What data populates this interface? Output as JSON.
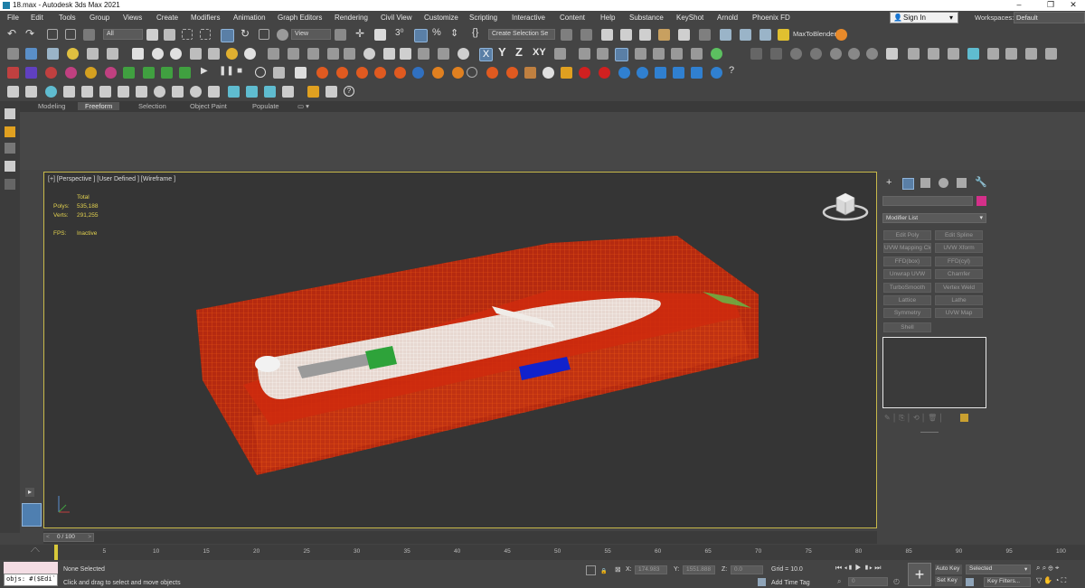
{
  "window": {
    "title": "18.max - Autodesk 3ds Max 2021",
    "minimize": "–",
    "restore": "❐",
    "close": "✕"
  },
  "menu": [
    "File",
    "Edit",
    "Tools",
    "Group",
    "Views",
    "Create",
    "Modifiers",
    "Animation",
    "Graph Editors",
    "Rendering",
    "Civil View",
    "Customize",
    "Scripting",
    "Interactive",
    "Content",
    "Help",
    "Substance",
    "KeyShot",
    "Arnold",
    "Phoenix FD"
  ],
  "account": {
    "signin": "Sign In",
    "workspaces_label": "Workspaces:",
    "workspace": "Default"
  },
  "toolbar": {
    "filter": "All",
    "refcoord": "View",
    "selset": "Create Selection Se",
    "x_label": "X",
    "y_label": "Y",
    "z_label": "Z",
    "xy_label": "XY",
    "plugin": "MaxToBlender"
  },
  "ribbon": {
    "tabs": [
      "Modeling",
      "Freeform",
      "Selection",
      "Object Paint",
      "Populate"
    ],
    "active": "Freeform"
  },
  "viewport": {
    "label": "[+] [Perspective ] [User Defined ] [Wireframe ]",
    "stats": {
      "header": "Total",
      "polys_label": "Polys:",
      "polys": "535,188",
      "verts_label": "Verts:",
      "verts": "291,255",
      "fps_label": "FPS:",
      "fps": "Inactive"
    }
  },
  "command_panel": {
    "modifier_list": "Modifier List",
    "buttons": [
      "Edit Poly",
      "Edit Spline",
      "UVW Mapping Cle",
      "UVW Xform",
      "FFD(box)",
      "FFD(cyl)",
      "Unwrap UVW",
      "Chamfer",
      "TurboSmooth",
      "Vertex Weld",
      "Lattice",
      "Lathe",
      "Symmetry",
      "UVW Map",
      "Shell"
    ],
    "color_swatch": "#d4308a"
  },
  "timeline": {
    "frame": "0 / 100",
    "ticks": [
      "5",
      "10",
      "15",
      "20",
      "25",
      "30",
      "35",
      "40",
      "45",
      "50",
      "55",
      "60",
      "65",
      "70",
      "75",
      "80",
      "85",
      "90",
      "95",
      "100"
    ]
  },
  "status": {
    "maxscript": "objs: #($Edi`",
    "selection": "None Selected",
    "prompt": "Click and drag to select and move objects",
    "x_label": "X:",
    "x": "174.983",
    "y_label": "Y:",
    "y": "1551.888",
    "z_label": "Z:",
    "z": "0.0",
    "grid": "Grid = 10.0",
    "add_time_tag": "Add Time Tag",
    "auto_key": "Auto Key",
    "set_key": "Set Key",
    "key_mode": "Selected",
    "key_filters": "Key Filters...",
    "frame_field": "0"
  }
}
